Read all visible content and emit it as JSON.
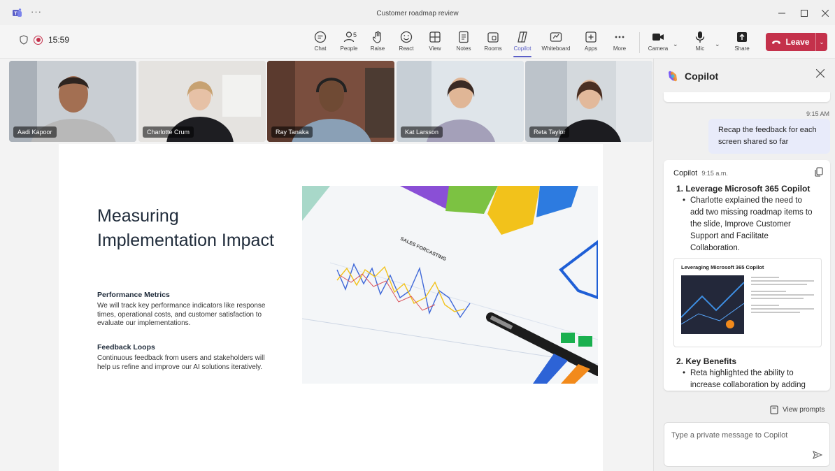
{
  "window": {
    "title": "Customer roadmap review",
    "menu_dots": "···"
  },
  "meeting": {
    "timer": "15:59"
  },
  "toolbar": {
    "chat": "Chat",
    "people": "People",
    "people_count": "5",
    "raise": "Raise",
    "react": "React",
    "view": "View",
    "notes": "Notes",
    "rooms": "Rooms",
    "copilot": "Copilot",
    "whiteboard": "Whiteboard",
    "apps": "Apps",
    "more": "More",
    "camera": "Camera",
    "mic": "Mic",
    "share": "Share",
    "leave": "Leave"
  },
  "participants": [
    {
      "name": "Aadi Kapoor"
    },
    {
      "name": "Charlotte Crum"
    },
    {
      "name": "Ray Tanaka"
    },
    {
      "name": "Kat Larsson"
    },
    {
      "name": "Reta Taylor"
    }
  ],
  "slide": {
    "title": "Measuring Implementation Impact",
    "section1_heading": "Performance Metrics",
    "section1_text": "We will track key performance indicators like response times, operational costs, and customer satisfaction to evaluate our implementations.",
    "section2_heading": "Feedback Loops",
    "section2_text": "Continuous feedback from users and stakeholders will help us refine and improve our AI solutions iteratively.",
    "photo_caption": "SALES FORCASTING"
  },
  "copilot": {
    "title": "Copilot",
    "user_time": "9:15 AM",
    "user_message": "Recap the feedback for each screen shared so far",
    "reply_author": "Copilot",
    "reply_time": "9:15 a.m.",
    "point1_heading": "1. Leverage Microsoft 365 Copilot",
    "point1_bullet": "Charlotte explained the need to add two missing roadmap items to the slide, Improve Customer Support and Facilitate Collaboration.",
    "thumbnail_title": "Leveraging Microsoft 365 Copilot",
    "point2_heading": "2. Key Benefits",
    "point2_bullet": "Reta highlighted the ability to increase collaboration by adding",
    "view_prompts": "View prompts",
    "input_placeholder": "Type a private message to Copilot"
  },
  "colors": {
    "accent": "#5b5fc7",
    "leave": "#c4314b",
    "user_bubble": "#e8ebfa"
  },
  "icons": [
    "teams-logo-icon",
    "shield-icon",
    "record-icon",
    "chat-icon",
    "people-icon",
    "raise-hand-icon",
    "react-icon",
    "view-icon",
    "notes-icon",
    "rooms-icon",
    "copilot-icon",
    "whiteboard-icon",
    "apps-icon",
    "more-icon",
    "camera-icon",
    "mic-icon",
    "share-icon",
    "phone-hangup-icon",
    "close-icon",
    "copy-icon",
    "prompts-icon",
    "send-icon"
  ]
}
